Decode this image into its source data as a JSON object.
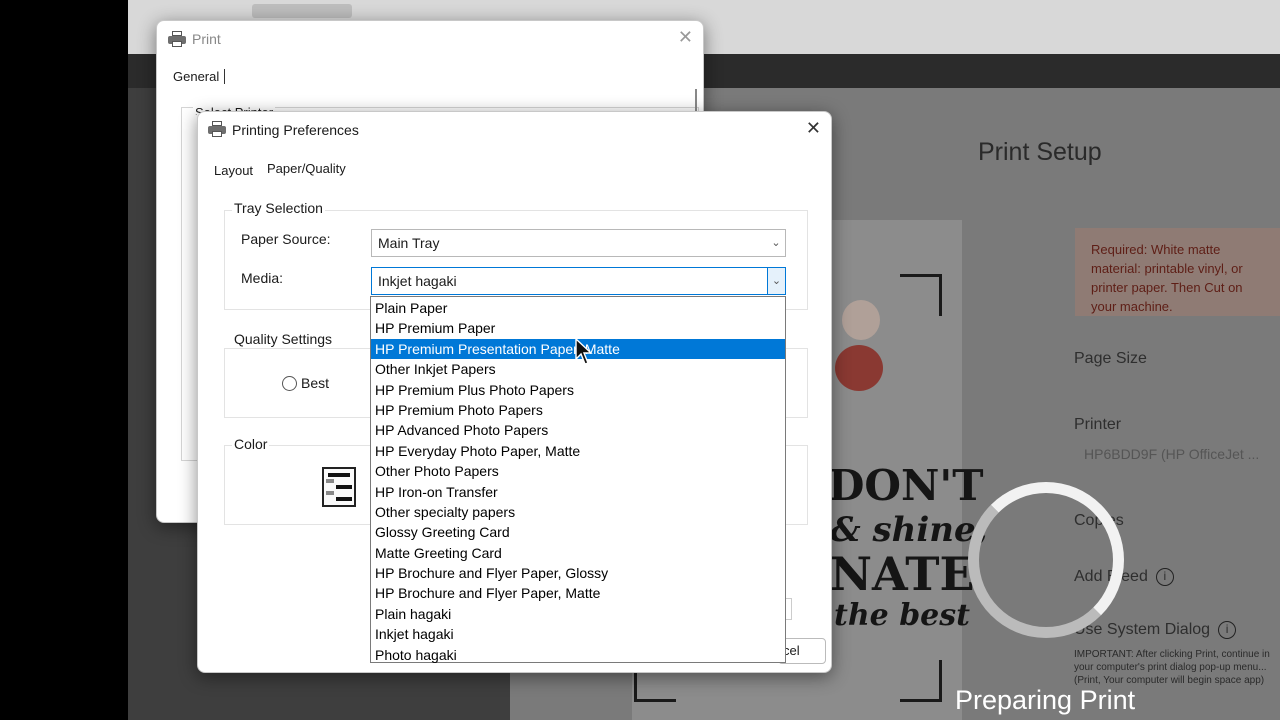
{
  "background_app": {
    "print_setup_title": "Print Setup",
    "required_text": "Required: White matte material: printable vinyl, or printer paper. Then Cut on your machine.",
    "page_size_label": "Page Size",
    "printer_label": "Printer",
    "printer_value": "HP6BDD9F (HP OfficeJet ...",
    "copies_label": "Copies",
    "add_bleed_label": "Add Bleed",
    "use_system_dialog_label": "Use System Dialog",
    "important_text": "IMPORTANT: After clicking Print, continue in your computer's print dialog pop-up menu... (Print, Your computer will begin space app)",
    "preparing_print": "Preparing Print",
    "artwork_lines": [
      "DON'T",
      "& shine,",
      "NATE",
      "the best"
    ]
  },
  "print_dialog": {
    "title": "Print",
    "tab_general": "General",
    "select_printer_label": "Select Printer"
  },
  "prefs_dialog": {
    "title": "Printing Preferences",
    "tabs": [
      "Layout",
      "Paper/Quality"
    ],
    "tray_selection_title": "Tray Selection",
    "paper_source_label": "Paper Source:",
    "paper_source_value": "Main Tray",
    "media_label": "Media:",
    "media_value": "Inkjet hagaki",
    "quality_settings_title": "Quality Settings",
    "quality_best_label": "Best",
    "color_title": "Color",
    "cancel_partial": "cel"
  },
  "media_options": [
    "Plain Paper",
    "HP Premium Paper",
    "HP Premium Presentation Paper, Matte",
    "Other Inkjet Papers",
    "HP Premium Plus Photo Papers",
    "HP Premium Photo Papers",
    "HP Advanced Photo Papers",
    "HP Everyday Photo Paper, Matte",
    "Other Photo Papers",
    "HP Iron-on Transfer",
    "Other specialty papers",
    "Glossy Greeting Card",
    "Matte Greeting Card",
    "HP Brochure and Flyer Paper, Glossy",
    "HP Brochure and Flyer Paper, Matte",
    "Plain hagaki",
    "Inkjet hagaki",
    "Photo hagaki"
  ],
  "highlighted_media_index": 2,
  "colors": {
    "selection": "#0078d7",
    "focus_border": "#0078d7"
  }
}
